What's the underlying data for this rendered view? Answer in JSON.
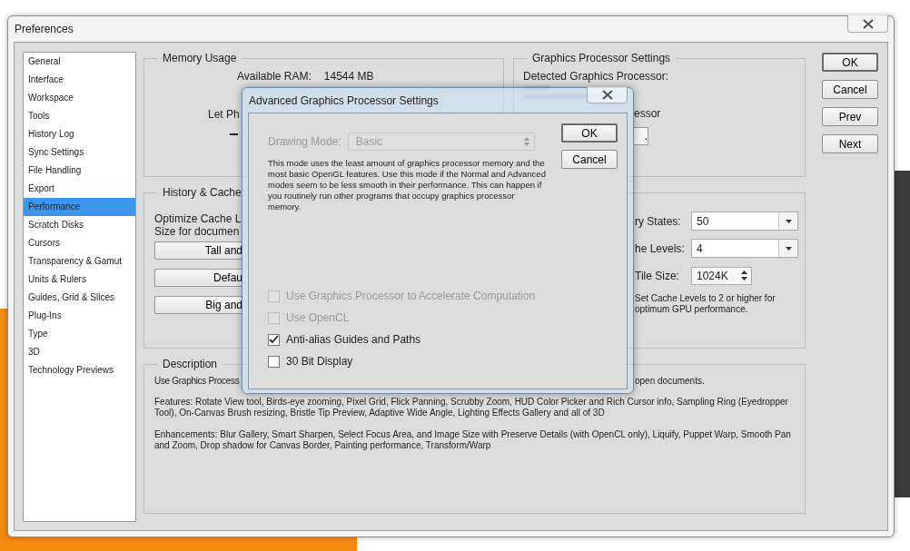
{
  "window": {
    "title": "Preferences"
  },
  "sidebar": {
    "items": [
      {
        "label": "General",
        "selected": false
      },
      {
        "label": "Interface",
        "selected": false
      },
      {
        "label": "Workspace",
        "selected": false
      },
      {
        "label": "Tools",
        "selected": false
      },
      {
        "label": "History Log",
        "selected": false
      },
      {
        "label": "Sync Settings",
        "selected": false
      },
      {
        "label": "File Handling",
        "selected": false
      },
      {
        "label": "Export",
        "selected": false
      },
      {
        "label": "Performance",
        "selected": true
      },
      {
        "label": "Scratch Disks",
        "selected": false
      },
      {
        "label": "Cursors",
        "selected": false
      },
      {
        "label": "Transparency & Gamut",
        "selected": false
      },
      {
        "label": "Units & Rulers",
        "selected": false
      },
      {
        "label": "Guides, Grid & Slices",
        "selected": false
      },
      {
        "label": "Plug-Ins",
        "selected": false
      },
      {
        "label": "Type",
        "selected": false
      },
      {
        "label": "3D",
        "selected": false
      },
      {
        "label": "Technology Previews",
        "selected": false
      }
    ]
  },
  "buttons": [
    {
      "label": "OK",
      "default": true
    },
    {
      "label": "Cancel",
      "default": false
    },
    {
      "label": "Prev",
      "default": false
    },
    {
      "label": "Next",
      "default": false
    }
  ],
  "memory_usage": {
    "title": "Memory Usage",
    "available_ram_label": "Available RAM:",
    "available_ram_value": "14544 MB",
    "let_label": "Let Ph"
  },
  "graphics_processor": {
    "title": "Graphics Processor Settings",
    "detected_label": "Detected Graphics Processor:",
    "use_label": "essor",
    "settings_button": "."
  },
  "history_cache": {
    "title": "History & Cache",
    "optimize_label": "Optimize Cache L",
    "optimize_label_2": "Size for documen",
    "preset_buttons": [
      "Tall and",
      "Defau",
      "Big and"
    ],
    "fields": [
      {
        "kind": "combo",
        "label": "ry States:",
        "value": "50"
      },
      {
        "kind": "combo",
        "label": "he Levels:",
        "value": "4"
      },
      {
        "kind": "spinner",
        "label": "Tile Size:",
        "value": "1024K"
      }
    ],
    "note": "Set Cache Levels to 2 or higher for optimum GPU performance."
  },
  "description": {
    "title": "Description",
    "first_line_left": "Use Graphics Process",
    "first_line_right": "open documents.",
    "paragraphs": [
      "Features: Rotate View tool, Birds-eye zooming, Pixel Grid, Flick Panning, Scrubby Zoom, HUD Color Picker and Rich Cursor info, Sampling Ring (Eyedropper Tool), On-Canvas Brush resizing, Bristle Tip Preview, Adaptive Wide Angle, Lighting Effects Gallery and all of 3D",
      "Enhancements: Blur Gallery, Smart Sharpen, Select Focus Area, and Image Size with Preserve Details (with OpenCL only), Liquify, Puppet Warp, Smooth Pan and Zoom, Drop shadow for Canvas Border, Painting performance, Transform/Warp"
    ]
  },
  "dialog": {
    "title": "Advanced Graphics Processor Settings",
    "drawing_mode": {
      "label": "Drawing Mode:",
      "value": "Basic",
      "disabled": true
    },
    "text": "This mode uses the least amount of graphics processor memory and the most basic OpenGL features.  Use this mode if the Normal and Advanced modes seem to be less smooth in their performance.  This can happen if you routinely run other programs that occupy graphics processor memory.",
    "buttons": [
      {
        "label": "OK",
        "default": true
      },
      {
        "label": "Cancel",
        "default": false
      }
    ],
    "options": [
      {
        "label": "Use Graphics Processor to Accelerate Computation",
        "checked": false,
        "disabled": true
      },
      {
        "label": "Use OpenCL",
        "checked": false,
        "disabled": true
      },
      {
        "label": "Anti-alias Guides and Paths",
        "checked": true,
        "disabled": false
      },
      {
        "label": "30 Bit Display",
        "checked": false,
        "disabled": false
      }
    ]
  }
}
